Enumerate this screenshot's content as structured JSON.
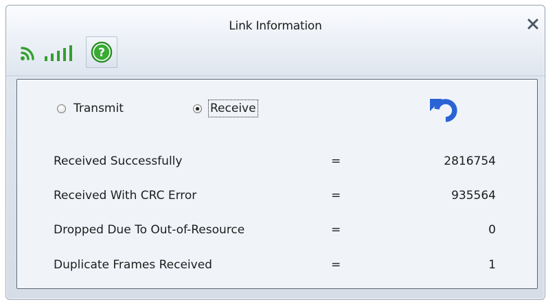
{
  "window": {
    "title": "Link Information"
  },
  "toolbar": {
    "icons": [
      "wifi-signal-icon",
      "signal-strength-bars-icon",
      "help-icon"
    ]
  },
  "mode": {
    "options": [
      {
        "label": "Transmit",
        "selected": false
      },
      {
        "label": "Receive",
        "selected": true
      }
    ]
  },
  "stats": {
    "rows": [
      {
        "label": "Received Successfully",
        "sep": "=",
        "value": "2816754"
      },
      {
        "label": "Received With CRC Error",
        "sep": "=",
        "value": "935564"
      },
      {
        "label": "Dropped Due To Out-of-Resource",
        "sep": "=",
        "value": "0"
      },
      {
        "label": "Duplicate Frames Received",
        "sep": "=",
        "value": "1"
      }
    ]
  },
  "colors": {
    "signal_green": "#33a02c",
    "help_green": "#3aaa35",
    "refresh_blue": "#2a63d4",
    "close_gray": "#4a5562"
  }
}
